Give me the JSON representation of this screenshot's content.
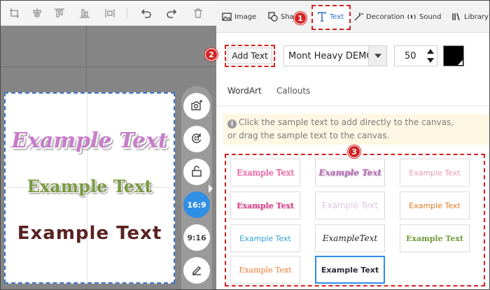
{
  "toolbar": {
    "icons": [
      "crop-icon",
      "align-center-icon",
      "align-top-icon",
      "align-bottom-icon",
      "distribute-icon",
      "undo-icon",
      "redo-icon",
      "delete-icon"
    ]
  },
  "canvas": {
    "samples": [
      "Example Text",
      "Example Text",
      "Example Text"
    ]
  },
  "side_tools": {
    "ratio_16_9": "16:9",
    "ratio_9_16": "9:16"
  },
  "tabs": {
    "image": "Image",
    "shape": "Sha",
    "text": "Text",
    "decoration": "Decoration",
    "sound": "Sound",
    "library": "Library"
  },
  "badges": {
    "one": "1",
    "two": "2",
    "three": "3"
  },
  "text_controls": {
    "add_text": "Add Text",
    "font": "Mont Heavy DEMO",
    "size": "50",
    "color": "#000000"
  },
  "subtabs": {
    "wordart": "WordArt",
    "callouts": "Callouts"
  },
  "hint": {
    "line1": "Click the sample text to add directly to the canvas,",
    "line2": "or drag the sample text to the canvas."
  },
  "samples": [
    "Example Text",
    "Example Text",
    "Example Text",
    "Example Text",
    "Example Text",
    "Example Text",
    "Example Text",
    "ExampleText",
    "Example Text",
    "Example Text",
    "Example Text"
  ],
  "colors": {
    "accent": "#2f8ee5",
    "annotation": "#d42121",
    "workspace": "#858585"
  }
}
